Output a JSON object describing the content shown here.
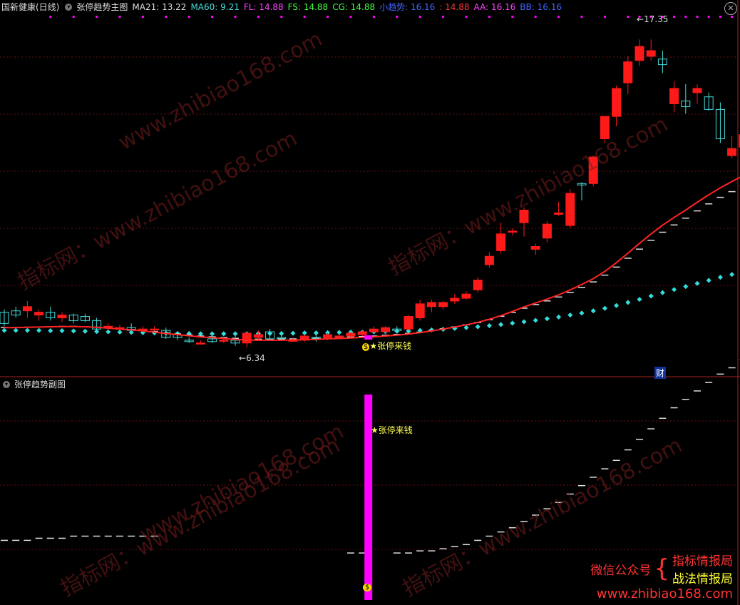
{
  "colors": {
    "background": "#000000",
    "up": "#ff1a1a",
    "down": "#44dddd",
    "ma_red": "#ff2222",
    "signal_magenta": "#ff00ff",
    "dots_cyan": "#33dddd",
    "dash_white": "#dddddd"
  },
  "header": {
    "stock": "国新健康(日线)",
    "indicator": "张停趋势主图",
    "items": [
      {
        "label": "MA21",
        "value": "13.22",
        "color": "#dddddd"
      },
      {
        "label": "MA60",
        "value": "9.21",
        "color": "#44dddd"
      },
      {
        "label": "FL",
        "value": "14.88",
        "color": "#ff44ff"
      },
      {
        "label": "FS",
        "value": "14.88",
        "color": "#44ff44"
      },
      {
        "label": "CG",
        "value": "14.88",
        "color": "#44ff44"
      },
      {
        "label": "小趋势",
        "value": "16.16",
        "color": "#4466ff"
      },
      {
        "label": "",
        "value": "14.88",
        "color": "#ff3333"
      },
      {
        "label": "AA",
        "value": "16.16",
        "color": "#ff44ff"
      },
      {
        "label": "BB",
        "value": "16.16",
        "color": "#4466ff"
      }
    ]
  },
  "sub_header": {
    "indicator": "张停趋势副图"
  },
  "annotations": {
    "high_label": "17.35",
    "low_label": "6.34",
    "signal_text": "张停来钱",
    "signal_text_sub": "张停来钱",
    "fin_badge": "财"
  },
  "watermarks": {
    "text1": "www.zhibiao168.com",
    "text2": "指标网：www.zhibiao168.com"
  },
  "footer": {
    "wechat": "微信公众号",
    "line1": "指标情报局",
    "line2": "战法情报局",
    "url": "www.zhibiao168.com"
  },
  "chart_data": [
    {
      "type": "candlestick",
      "title": "张停趋势主图",
      "ylim": [
        5.5,
        18.2
      ],
      "candles": [
        [
          7.6,
          7.7,
          7.1,
          7.2
        ],
        [
          7.65,
          7.8,
          7.4,
          7.5
        ],
        [
          7.65,
          8.0,
          7.4,
          7.8
        ],
        [
          7.5,
          7.7,
          7.3,
          7.6
        ],
        [
          7.6,
          7.8,
          7.3,
          7.4
        ],
        [
          7.4,
          7.6,
          7.25,
          7.5
        ],
        [
          7.5,
          7.55,
          7.2,
          7.3
        ],
        [
          7.45,
          7.55,
          7.25,
          7.3
        ],
        [
          7.3,
          7.4,
          6.9,
          7.0
        ],
        [
          7.05,
          7.2,
          6.95,
          7.1
        ],
        [
          7.05,
          7.15,
          6.95,
          7.05
        ],
        [
          7.05,
          7.2,
          6.9,
          6.95
        ],
        [
          7.0,
          7.1,
          6.9,
          7.0
        ],
        [
          7.0,
          7.1,
          6.95,
          7.0
        ],
        [
          6.95,
          7.05,
          6.65,
          6.7
        ],
        [
          6.8,
          6.9,
          6.6,
          6.7
        ],
        [
          6.6,
          6.7,
          6.5,
          6.55
        ],
        [
          6.5,
          6.6,
          6.45,
          6.5
        ],
        [
          6.65,
          6.75,
          6.5,
          6.55
        ],
        [
          6.6,
          6.7,
          6.5,
          6.6
        ],
        [
          6.6,
          6.75,
          6.4,
          6.5
        ],
        [
          6.5,
          6.9,
          6.34,
          6.85
        ],
        [
          6.7,
          6.95,
          6.6,
          6.8
        ],
        [
          6.9,
          7.0,
          6.6,
          6.65
        ],
        [
          6.7,
          6.8,
          6.6,
          6.68
        ],
        [
          6.6,
          6.7,
          6.55,
          6.6
        ],
        [
          6.6,
          6.8,
          6.55,
          6.75
        ],
        [
          6.7,
          6.8,
          6.55,
          6.65
        ],
        [
          6.65,
          6.85,
          6.6,
          6.8
        ],
        [
          6.7,
          6.8,
          6.65,
          6.75
        ],
        [
          6.75,
          6.9,
          6.7,
          6.85
        ],
        [
          6.8,
          6.95,
          6.75,
          6.9
        ],
        [
          6.9,
          7.1,
          6.85,
          7.0
        ],
        [
          6.9,
          7.1,
          6.85,
          7.05
        ],
        [
          7.0,
          7.1,
          6.9,
          6.95
        ],
        [
          7.0,
          7.5,
          6.95,
          7.45
        ],
        [
          7.4,
          8.05,
          7.3,
          7.9
        ],
        [
          7.8,
          8.05,
          7.6,
          7.95
        ],
        [
          7.8,
          8.0,
          7.7,
          7.95
        ],
        [
          8.0,
          8.25,
          7.9,
          8.1
        ],
        [
          8.1,
          8.35,
          8.05,
          8.25
        ],
        [
          8.4,
          8.85,
          8.3,
          8.75
        ],
        [
          9.3,
          9.75,
          9.2,
          9.6
        ],
        [
          9.8,
          10.8,
          9.7,
          10.4
        ],
        [
          10.5,
          10.6,
          10.35,
          10.5
        ],
        [
          10.8,
          11.35,
          10.3,
          11.25
        ],
        [
          9.85,
          10.05,
          9.65,
          9.95
        ],
        [
          10.25,
          10.85,
          10.1,
          10.75
        ],
        [
          11.1,
          11.55,
          11.05,
          11.15
        ],
        [
          10.7,
          12.0,
          10.6,
          11.85
        ],
        [
          12.2,
          12.25,
          11.6,
          12.15
        ],
        [
          12.2,
          13.2,
          12.1,
          13.15
        ],
        [
          13.8,
          14.15,
          13.65,
          14.6
        ],
        [
          14.6,
          15.7,
          14.25,
          15.6
        ],
        [
          15.8,
          16.75,
          15.4,
          16.55
        ],
        [
          16.6,
          17.35,
          16.4,
          17.1
        ],
        [
          16.75,
          17.35,
          16.6,
          16.95
        ],
        [
          16.65,
          16.95,
          16.15,
          16.45
        ],
        [
          15.05,
          15.85,
          14.75,
          15.6
        ],
        [
          15.15,
          15.75,
          14.7,
          14.95
        ],
        [
          15.45,
          15.75,
          15.05,
          15.6
        ],
        [
          15.3,
          15.45,
          14.8,
          14.85
        ],
        [
          14.85,
          15.1,
          13.65,
          13.8
        ],
        [
          13.2,
          13.9,
          13.1,
          13.45
        ],
        [
          13.5,
          14.15,
          13.4,
          13.95
        ]
      ],
      "series": [
        {
          "name": "MA21",
          "values": [
            7.05,
            7.05,
            7.06,
            7.07,
            7.08,
            7.09,
            7.09,
            7.08,
            7.06,
            7.03,
            7.0,
            6.97,
            6.93,
            6.89,
            6.84,
            6.8,
            6.76,
            6.72,
            6.69,
            6.66,
            6.63,
            6.61,
            6.6,
            6.6,
            6.6,
            6.61,
            6.62,
            6.63,
            6.65,
            6.66,
            6.68,
            6.7,
            6.72,
            6.75,
            6.78,
            6.82,
            6.87,
            6.93,
            7.0,
            7.07,
            7.15,
            7.24,
            7.35,
            7.48,
            7.63,
            7.79,
            7.93,
            8.07,
            8.22,
            8.4,
            8.59,
            8.8,
            9.06,
            9.37,
            9.71,
            10.06,
            10.4,
            10.71,
            10.99,
            11.25,
            11.53,
            11.8,
            12.05,
            12.27,
            12.49
          ]
        },
        {
          "name": "MA60",
          "values": [
            6.95,
            6.95,
            6.95,
            6.95,
            6.94,
            6.94,
            6.93,
            6.92,
            6.91,
            6.9,
            6.89,
            6.88,
            6.87,
            6.86,
            6.85,
            6.84,
            6.84,
            6.83,
            6.83,
            6.83,
            6.83,
            6.83,
            6.84,
            6.84,
            6.84,
            6.85,
            6.86,
            6.86,
            6.87,
            6.88,
            6.89,
            6.89,
            6.9,
            6.91,
            6.92,
            6.93,
            6.95,
            6.97,
            6.99,
            7.02,
            7.05,
            7.08,
            7.12,
            7.16,
            7.21,
            7.26,
            7.31,
            7.37,
            7.43,
            7.5,
            7.57,
            7.65,
            7.74,
            7.84,
            7.95,
            8.06,
            8.18,
            8.3,
            8.41,
            8.52,
            8.63,
            8.74,
            8.85,
            8.95,
            9.21
          ]
        }
      ]
    },
    {
      "type": "line",
      "title": "张停趋势副图",
      "x": [
        0,
        1,
        2,
        3,
        4,
        5,
        6,
        7,
        8,
        9,
        10,
        11,
        12,
        13,
        14,
        15,
        16,
        17,
        18,
        19,
        20,
        21,
        22,
        23,
        24,
        25,
        26,
        27,
        28,
        29,
        30,
        31,
        32,
        33,
        34,
        35,
        36,
        37,
        38,
        39,
        40,
        41,
        42,
        43,
        44,
        45,
        46,
        47,
        48,
        49,
        50,
        51,
        52,
        53,
        54,
        55,
        56,
        57,
        58,
        59,
        60,
        61,
        62,
        63,
        64
      ],
      "series": [
        {
          "name": "trend",
          "values": [
            0.28,
            0.28,
            0.28,
            0.29,
            0.29,
            0.29,
            0.3,
            0.3,
            0.3,
            0.3,
            0.3,
            0.3,
            0.3,
            0.3,
            null,
            null,
            null,
            null,
            null,
            null,
            null,
            null,
            null,
            null,
            null,
            null,
            null,
            null,
            null,
            null,
            0.22,
            0.22,
            null,
            null,
            0.22,
            0.22,
            0.23,
            0.23,
            0.24,
            0.25,
            0.26,
            0.28,
            0.3,
            0.32,
            0.34,
            0.37,
            0.4,
            0.43,
            0.46,
            0.5,
            0.54,
            0.58,
            0.62,
            0.66,
            0.71,
            0.76,
            0.81,
            0.86,
            0.91,
            0.95,
            0.99,
            1.03,
            1.07,
            1.1,
            1.14
          ]
        }
      ],
      "signal_bar_index": 31
    }
  ]
}
